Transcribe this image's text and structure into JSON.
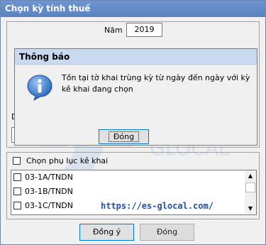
{
  "window": {
    "title": "Chọn kỳ tính thuế"
  },
  "year": {
    "label": "Năm",
    "value": "2019"
  },
  "obscured": {
    "fragment_label": "D"
  },
  "appendix": {
    "label": "Chọn phụ lục kê khai",
    "items": [
      {
        "label": "03-1A/TNDN"
      },
      {
        "label": "03-1B/TNDN"
      },
      {
        "label": "03-1C/TNDN"
      }
    ]
  },
  "buttons": {
    "ok": "Đồng ý",
    "close": "Đóng"
  },
  "watermark": {
    "text": "https://es-glocal.com/",
    "logo_text": "ES",
    "logo_sub": "GLOCAL"
  },
  "dialog": {
    "title": "Thông báo",
    "message": "Tồn tại tờ khai trùng kỳ từ ngày đến ngày với kỳ kê khai đang chọn",
    "button": "Đóng",
    "icon": "info-icon"
  },
  "colors": {
    "titlebar": "#5b82c0",
    "dialog_header": "#c9daf0",
    "focus_border": "#0078d7",
    "watermark_url": "#2250a6"
  }
}
